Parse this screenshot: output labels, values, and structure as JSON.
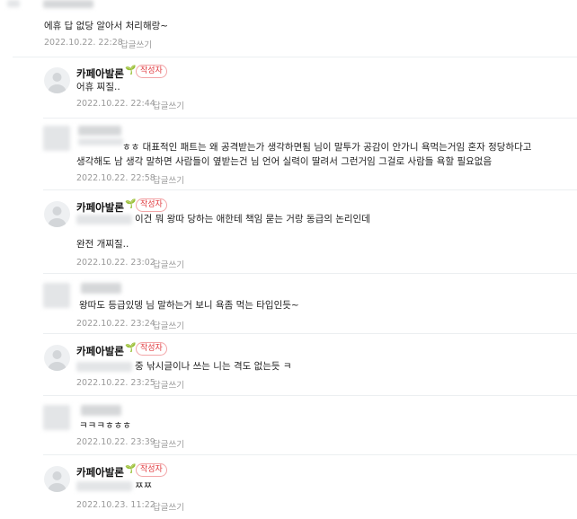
{
  "colors": {
    "badge": "#e0393e",
    "meta": "#9a9a9a",
    "nickname": "#111111",
    "leaf": "#3aaa3a"
  },
  "icons": {
    "author_mark": "sprout-leaf-icon",
    "avatar": "default-avatar-icon"
  },
  "comments": [
    {
      "text": "에휴 답 없당 알아서 처리해랑~",
      "date": "2022.10.22. 22:28",
      "reply": "답글쓰기"
    },
    {
      "nickname": "카페아발론",
      "badge": "작성자",
      "text": "어휴 찌질..",
      "date": "2022.10.22. 22:44",
      "reply": "답글쓰기"
    },
    {
      "text_line1": "ㅎㅎ 대표적인 패트는 왜 공격받는가 생각하면됨 님이 말투가 공감이 안가니 욕먹는거임 혼자 정당하다고",
      "text_line2": "생각해도 남 생각 말하면 사람들이 옆받는건 님 언어 실력이 딸려서 그런거임 그걸로 사람들 욕할 필요없음",
      "date": "2022.10.22. 22:58",
      "reply": "답글쓰기"
    },
    {
      "nickname": "카페아발론",
      "badge": "작성자",
      "text_line1": "이건 뭐 왕따 당하는 애한테 책임 묻는 거랑 동급의 논리인데",
      "text_line2": "완전 개찌질..",
      "date": "2022.10.22. 23:02",
      "reply": "답글쓰기"
    },
    {
      "text": "왕따도 등급있뎅 님 말하는거 보니 욕좀 먹는 타입인듯~",
      "date": "2022.10.22. 23:24",
      "reply": "답글쓰기"
    },
    {
      "nickname": "카페아발론",
      "badge": "작성자",
      "text": "중 낚시글이나 쓰는 니는 격도 없는듯 ㅋ",
      "date": "2022.10.22. 23:25",
      "reply": "답글쓰기"
    },
    {
      "text": "ㅋㅋㅋㅎㅎㅎ",
      "date": "2022.10.22. 23:39",
      "reply": "답글쓰기"
    },
    {
      "nickname": "카페아발론",
      "badge": "작성자",
      "text": "ㅉㅉ",
      "date": "2022.10.23. 11:22",
      "reply": "답글쓰기"
    }
  ]
}
